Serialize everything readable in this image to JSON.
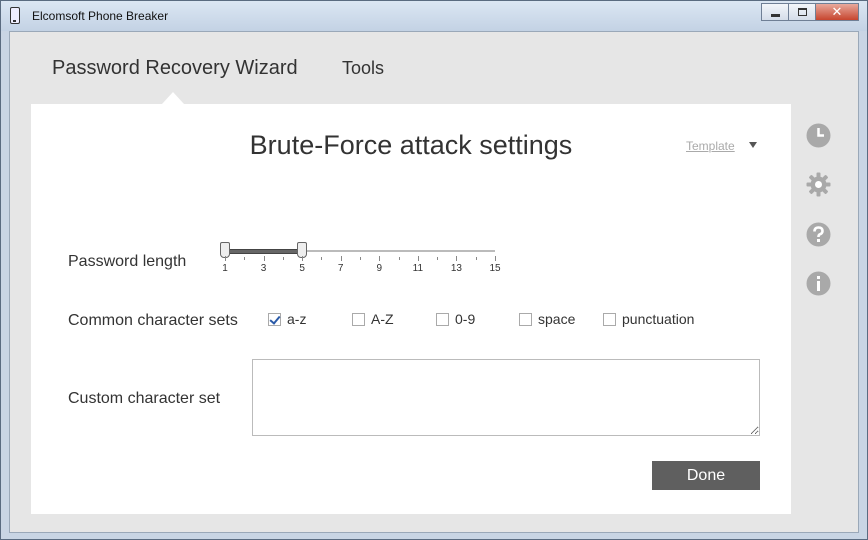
{
  "window": {
    "title": "Elcomsoft Phone Breaker"
  },
  "nav": {
    "tabs": [
      {
        "label": "Password Recovery Wizard"
      },
      {
        "label": "Tools"
      }
    ]
  },
  "panel": {
    "title": "Brute-Force attack settings",
    "template_label": "Template",
    "password_length": {
      "label": "Password length",
      "ticks": [
        "1",
        "3",
        "5",
        "7",
        "9",
        "11",
        "13",
        "15"
      ],
      "range_min": 1,
      "range_max": 15,
      "selected_min": 1,
      "selected_max": 5
    },
    "charsets": {
      "label": "Common character sets",
      "options": [
        {
          "label": "a-z",
          "checked": true
        },
        {
          "label": "A-Z",
          "checked": false
        },
        {
          "label": "0-9",
          "checked": false
        },
        {
          "label": "space",
          "checked": false
        },
        {
          "label": "punctuation",
          "checked": false
        }
      ]
    },
    "custom_charset": {
      "label": "Custom character set",
      "value": ""
    },
    "done_label": "Done"
  },
  "side_icons": [
    "clock-icon",
    "gear-icon",
    "help-icon",
    "info-icon"
  ],
  "colors": {
    "side_icon": "#a9a9a9",
    "done_button": "#5f5f5f",
    "checkmark": "#2a5aa8"
  }
}
